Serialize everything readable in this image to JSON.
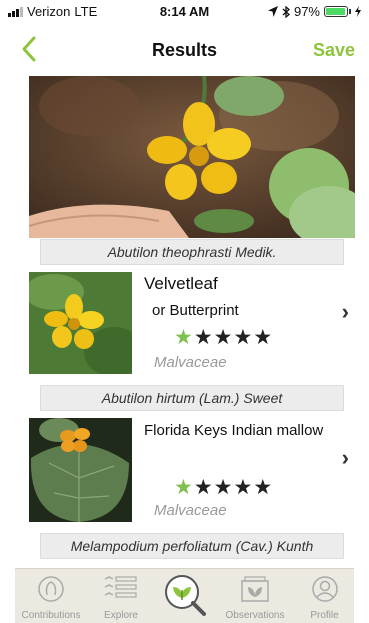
{
  "status_bar": {
    "carrier": "Verizon",
    "network": "LTE",
    "time": "8:14 AM",
    "battery": "97%",
    "battery_level": 0.97
  },
  "nav": {
    "title": "Results",
    "save_label": "Save"
  },
  "results": [
    {
      "scientific_name": "Abutilon theophrasti Medik.",
      "common_name_1": "Velvetleaf",
      "common_name_2": "or Butterprint",
      "family": "Malvaceae",
      "rating": 1,
      "rating_max": 5
    },
    {
      "scientific_name": "Abutilon hirtum (Lam.) Sweet",
      "common_name_1": "Florida Keys Indian mallow",
      "common_name_2": "",
      "family": "Malvaceae",
      "rating": 1,
      "rating_max": 5
    },
    {
      "scientific_name": "Melampodium perfoliatum (Cav.) Kunth"
    }
  ],
  "tabs": [
    {
      "label": "Contributions",
      "icon": "contributions-icon"
    },
    {
      "label": "Explore",
      "icon": "explore-icon"
    },
    {
      "label": "",
      "icon": "identify-search-icon"
    },
    {
      "label": "Observations",
      "icon": "observations-icon"
    },
    {
      "label": "Profile",
      "icon": "profile-icon"
    }
  ],
  "colors": {
    "accent": "#8cc43c",
    "star_on": "#7fbf4f",
    "star_off": "#222222",
    "tab_bar": "#ece9e0"
  }
}
